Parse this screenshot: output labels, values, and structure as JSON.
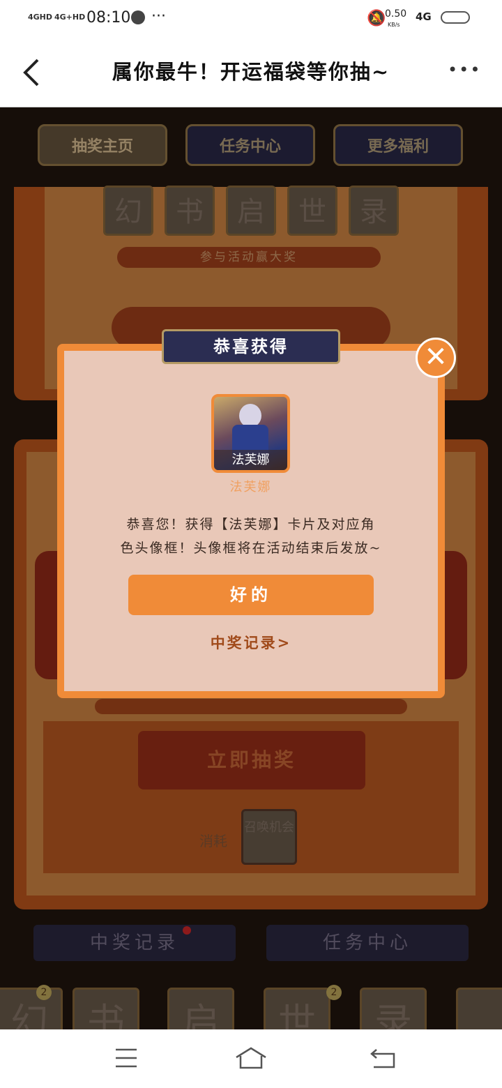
{
  "status_bar": {
    "signal_1": "4GHD",
    "signal_2": "4G+HD",
    "time": "08:10",
    "more": "···",
    "network_speed": "0.50",
    "network_unit": "KB/s",
    "net_type": "4G"
  },
  "nav": {
    "title": "属你最牛！开运福袋等你抽~",
    "more": "•••"
  },
  "tabs": [
    {
      "label": "抽奖主页"
    },
    {
      "label": "任务中心"
    },
    {
      "label": "更多福利"
    }
  ],
  "machine": {
    "tiles": [
      "幻",
      "书",
      "启",
      "世",
      "录"
    ],
    "slogan": "参与活动赢大奖",
    "draw_button": "立即抽奖",
    "cost_label": "消耗",
    "cost_item": "召唤机会"
  },
  "bottom_buttons": {
    "records": "中奖记录",
    "tasks": "任务中心"
  },
  "inventory": [
    {
      "char": "幻",
      "count": "2"
    },
    {
      "char": "书",
      "count": ""
    },
    {
      "char": "启",
      "count": ""
    },
    {
      "char": "世",
      "count": "2"
    },
    {
      "char": "录",
      "count": ""
    }
  ],
  "modal": {
    "banner": "恭喜获得",
    "card_label": "法芙娜",
    "card_name": "法芙娜",
    "message_line1": "恭喜您！获得【法芙娜】卡片及对应角",
    "message_line2": "色头像框！头像框将在活动结束后发放~",
    "ok_button": "好的",
    "record_link": "中奖记录>"
  },
  "colors": {
    "accent": "#f08b38",
    "modal_bg": "#e9c8b8",
    "banner_bg": "#2b2d52"
  }
}
